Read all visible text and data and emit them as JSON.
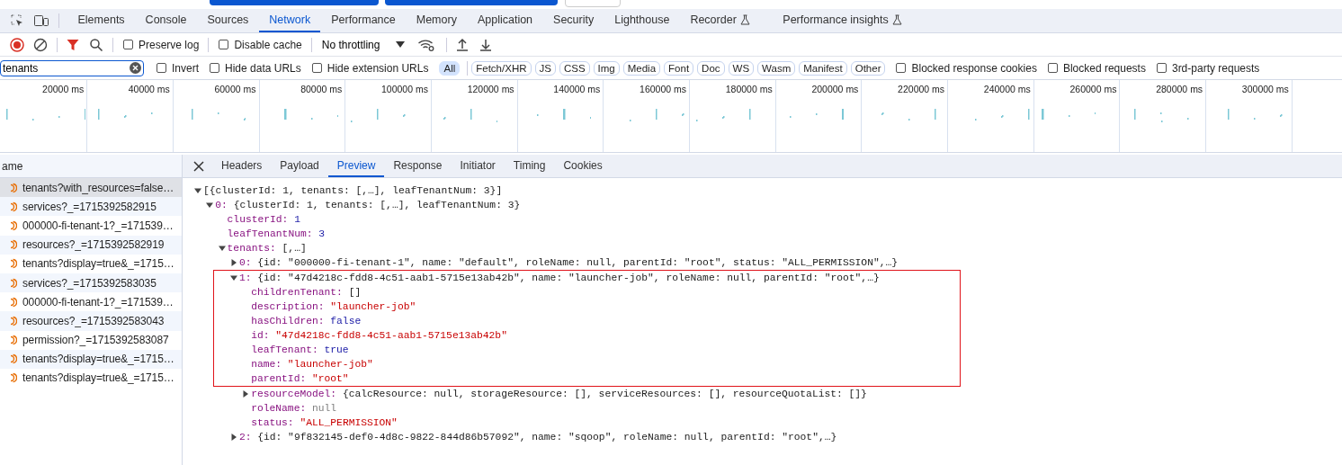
{
  "devtools_tabs": [
    {
      "label": "Elements",
      "selected": false,
      "experimental": false
    },
    {
      "label": "Console",
      "selected": false,
      "experimental": false
    },
    {
      "label": "Sources",
      "selected": false,
      "experimental": false
    },
    {
      "label": "Network",
      "selected": true,
      "experimental": false
    },
    {
      "label": "Performance",
      "selected": false,
      "experimental": false
    },
    {
      "label": "Memory",
      "selected": false,
      "experimental": false
    },
    {
      "label": "Application",
      "selected": false,
      "experimental": false
    },
    {
      "label": "Security",
      "selected": false,
      "experimental": false
    },
    {
      "label": "Lighthouse",
      "selected": false,
      "experimental": false
    },
    {
      "label": "Recorder",
      "selected": false,
      "experimental": true
    },
    {
      "label": "Performance insights",
      "selected": false,
      "experimental": true
    }
  ],
  "toolbar": {
    "recording": true,
    "filter_active": true,
    "options": [
      {
        "label": "Preserve log",
        "checked": false
      },
      {
        "label": "Disable cache",
        "checked": false
      }
    ],
    "throttling": "No throttling"
  },
  "filter_bar": {
    "search": {
      "value": "tenants"
    },
    "options": [
      {
        "label": "Invert",
        "checked": false
      },
      {
        "label": "Hide data URLs",
        "checked": false
      },
      {
        "label": "Hide extension URLs",
        "checked": false
      }
    ],
    "types": [
      {
        "label": "All",
        "selected": true
      },
      {
        "label": "Fetch/XHR",
        "selected": false
      },
      {
        "label": "JS",
        "selected": false
      },
      {
        "label": "CSS",
        "selected": false
      },
      {
        "label": "Img",
        "selected": false
      },
      {
        "label": "Media",
        "selected": false
      },
      {
        "label": "Font",
        "selected": false
      },
      {
        "label": "Doc",
        "selected": false
      },
      {
        "label": "WS",
        "selected": false
      },
      {
        "label": "Wasm",
        "selected": false
      },
      {
        "label": "Manifest",
        "selected": false
      },
      {
        "label": "Other",
        "selected": false
      }
    ],
    "extra_options": [
      {
        "label": "Blocked response cookies",
        "checked": false
      },
      {
        "label": "Blocked requests",
        "checked": false
      },
      {
        "label": "3rd-party requests",
        "checked": false
      }
    ]
  },
  "overview": {
    "ticks": [
      "20000 ms",
      "40000 ms",
      "60000 ms",
      "80000 ms",
      "100000 ms",
      "120000 ms",
      "140000 ms",
      "160000 ms",
      "180000 ms",
      "200000 ms",
      "220000 ms",
      "240000 ms",
      "260000 ms",
      "280000 ms",
      "300000 ms"
    ]
  },
  "requests": {
    "header": "ame",
    "rows": [
      {
        "name": "tenants?with_resources=false…",
        "selected": true
      },
      {
        "name": "services?_=1715392582915",
        "selected": false
      },
      {
        "name": "000000-fi-tenant-1?_=171539…",
        "selected": false
      },
      {
        "name": "resources?_=1715392582919",
        "selected": false
      },
      {
        "name": "tenants?display=true&_=1715…",
        "selected": false
      },
      {
        "name": "services?_=1715392583035",
        "selected": false
      },
      {
        "name": "000000-fi-tenant-1?_=171539…",
        "selected": false
      },
      {
        "name": "resources?_=1715392583043",
        "selected": false
      },
      {
        "name": "permission?_=1715392583087",
        "selected": false
      },
      {
        "name": "tenants?display=true&_=1715…",
        "selected": false
      },
      {
        "name": "tenants?display=true&_=1715…",
        "selected": false
      }
    ]
  },
  "details": {
    "tabs": [
      {
        "label": "Headers",
        "selected": false
      },
      {
        "label": "Payload",
        "selected": false
      },
      {
        "label": "Preview",
        "selected": true
      },
      {
        "label": "Response",
        "selected": false
      },
      {
        "label": "Initiator",
        "selected": false
      },
      {
        "label": "Timing",
        "selected": false
      },
      {
        "label": "Cookies",
        "selected": false
      }
    ],
    "preview": [
      {
        "kind": "object",
        "value": "[{clusterId: 1, tenants: [,…], leafTenantNum: 3}]",
        "expanded": true,
        "highlighted": false,
        "children": [
          {
            "kind": "object",
            "key": "0:",
            "value": "{clusterId: 1, tenants: [,…], leafTenantNum: 3}",
            "expanded": true,
            "highlighted": false,
            "children": [
              {
                "kind": "number",
                "key": "clusterId:",
                "value": "1",
                "highlighted": false
              },
              {
                "kind": "number",
                "key": "leafTenantNum:",
                "value": "3",
                "highlighted": false
              },
              {
                "kind": "object",
                "key": "tenants:",
                "value": "[,…]",
                "expanded": true,
                "highlighted": false,
                "children": [
                  {
                    "kind": "object",
                    "key": "0:",
                    "value": "{id: \"000000-fi-tenant-1\", name: \"default\", roleName: null, parentId: \"root\", status: \"ALL_PERMISSION\",…}",
                    "expanded": false,
                    "highlighted": false
                  },
                  {
                    "kind": "object",
                    "key": "1:",
                    "value": "{id: \"47d4218c-fdd8-4c51-aab1-5715e13ab42b\", name: \"launcher-job\", roleName: null, parentId: \"root\",…}",
                    "expanded": true,
                    "highlighted": true,
                    "children": [
                      {
                        "kind": "array",
                        "key": "childrenTenant:",
                        "value": "[]",
                        "highlighted": true
                      },
                      {
                        "kind": "string",
                        "key": "description:",
                        "value": "\"launcher-job\"",
                        "highlighted": true
                      },
                      {
                        "kind": "boolean",
                        "key": "hasChildren:",
                        "value": "false",
                        "highlighted": true
                      },
                      {
                        "kind": "string",
                        "key": "id:",
                        "value": "\"47d4218c-fdd8-4c51-aab1-5715e13ab42b\"",
                        "highlighted": true
                      },
                      {
                        "kind": "boolean",
                        "key": "leafTenant:",
                        "value": "true",
                        "highlighted": true
                      },
                      {
                        "kind": "string",
                        "key": "name:",
                        "value": "\"launcher-job\"",
                        "highlighted": true
                      },
                      {
                        "kind": "string",
                        "key": "parentId:",
                        "value": "\"root\"",
                        "highlighted": true
                      },
                      {
                        "kind": "object",
                        "key": "resourceModel:",
                        "value": "{calcResource: null, storageResource: [], serviceResources: [], resourceQuotaList: []}",
                        "expanded": false,
                        "highlighted": false
                      },
                      {
                        "kind": "null",
                        "key": "roleName:",
                        "value": "null",
                        "highlighted": false
                      },
                      {
                        "kind": "string",
                        "key": "status:",
                        "value": "\"ALL_PERMISSION\"",
                        "highlighted": false
                      }
                    ]
                  },
                  {
                    "kind": "object",
                    "key": "2:",
                    "value": "{id: \"9f832145-def0-4d8c-9822-844d86b57092\", name: \"sqoop\", roleName: null, parentId: \"root\",…}",
                    "expanded": false,
                    "highlighted": false
                  }
                ]
              }
            ]
          }
        ]
      }
    ]
  }
}
